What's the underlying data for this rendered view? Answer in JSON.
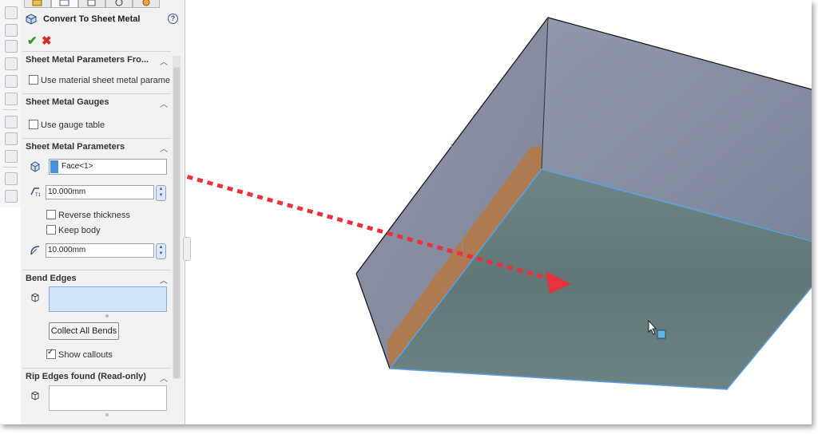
{
  "property_manager": {
    "title": "Convert To Sheet Metal",
    "help_label": "?",
    "ok_label": "✔",
    "cancel_label": "✖"
  },
  "sections": {
    "params_from_material": {
      "title": "Sheet Metal Parameters Fro...",
      "checkbox_label": "Use material sheet metal parame",
      "checked": false
    },
    "gauges": {
      "title": "Sheet Metal Gauges",
      "checkbox_label": "Use gauge table",
      "checked": false
    },
    "parameters": {
      "title": "Sheet Metal Parameters",
      "face_value": "Face<1>",
      "thickness_value": "10.000mm",
      "reverse_thickness_label": "Reverse thickness",
      "reverse_thickness_checked": false,
      "keep_body_label": "Keep body",
      "keep_body_checked": false,
      "radius_value": "10.000mm"
    },
    "bend_edges": {
      "title": "Bend Edges",
      "collect_button_label": "Collect All Bends",
      "show_callouts_label": "Show callouts",
      "show_callouts_checked": true
    },
    "rip_edges": {
      "title": "Rip Edges found (Read-only)"
    }
  },
  "colors": {
    "selected_face": "#4a90e2",
    "model_face_top": "#7b869e",
    "model_face_bottom": "#5f7373",
    "edge_face": "#b8804f",
    "arrow": "#e8323c"
  }
}
